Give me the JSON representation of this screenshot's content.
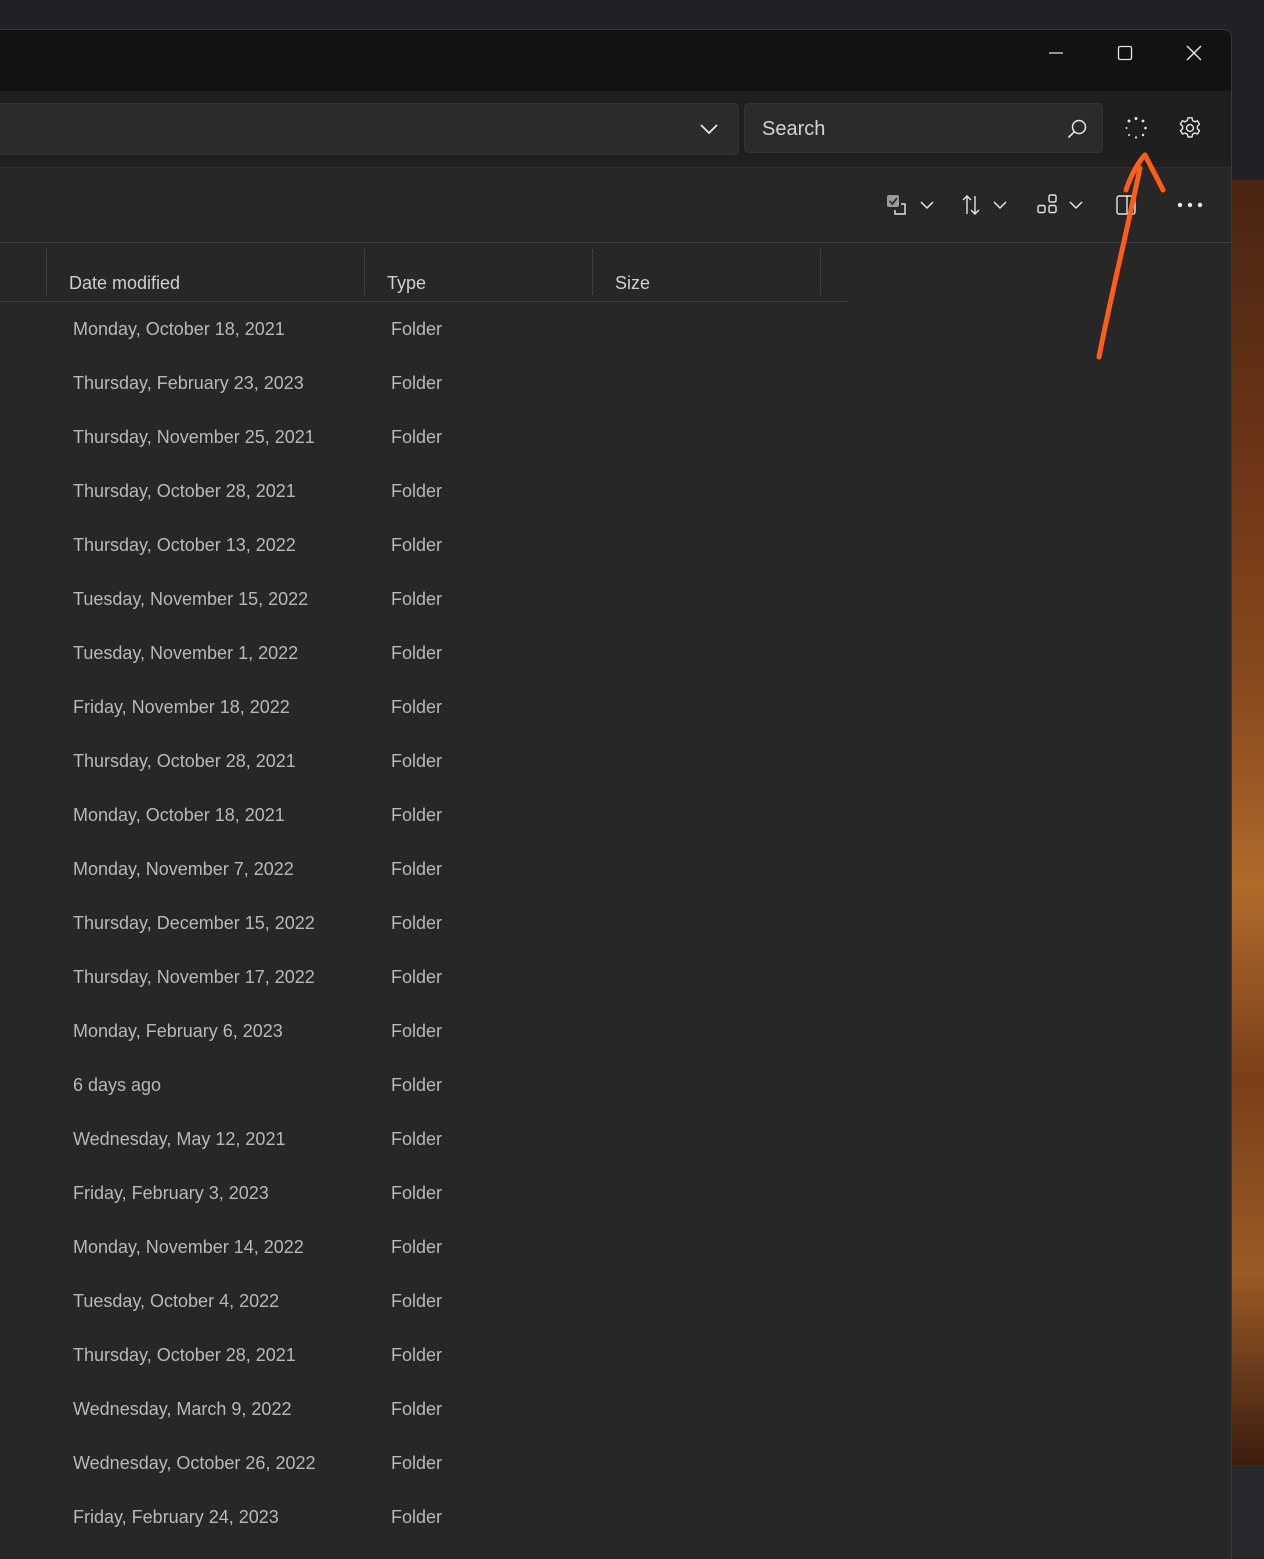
{
  "window": {
    "caption": {
      "minimize_icon": "minimize-icon",
      "maximize_icon": "maximize-icon",
      "close_icon": "close-icon"
    }
  },
  "address_bar": {
    "value": "",
    "dropdown_icon": "chevron-down-icon"
  },
  "search": {
    "placeholder": "Search",
    "icon": "search-icon"
  },
  "toolbar": {
    "sync_icon": "sync-status-icon",
    "settings_icon": "gear-icon",
    "select_icon": "select-check-icon",
    "sort_icon": "sort-icon",
    "layout_icon": "layout-icon",
    "preview_icon": "preview-pane-icon",
    "more_icon": "more-options-icon"
  },
  "columns": {
    "date_modified": "Date modified",
    "type": "Type",
    "size": "Size"
  },
  "rows": [
    {
      "date": "Monday, October 18, 2021",
      "type": "Folder"
    },
    {
      "date": "Thursday, February 23, 2023",
      "type": "Folder"
    },
    {
      "date": "Thursday, November 25, 2021",
      "type": "Folder"
    },
    {
      "date": "Thursday, October 28, 2021",
      "type": "Folder"
    },
    {
      "date": "Thursday, October 13, 2022",
      "type": "Folder"
    },
    {
      "date": "Tuesday, November 15, 2022",
      "type": "Folder"
    },
    {
      "date": "Tuesday, November 1, 2022",
      "type": "Folder"
    },
    {
      "date": "Friday, November 18, 2022",
      "type": "Folder"
    },
    {
      "date": "Thursday, October 28, 2021",
      "type": "Folder"
    },
    {
      "date": "Monday, October 18, 2021",
      "type": "Folder"
    },
    {
      "date": "Monday, November 7, 2022",
      "type": "Folder"
    },
    {
      "date": "Thursday, December 15, 2022",
      "type": "Folder"
    },
    {
      "date": "Thursday, November 17, 2022",
      "type": "Folder"
    },
    {
      "date": "Monday, February 6, 2023",
      "type": "Folder"
    },
    {
      "date": "6 days ago",
      "type": "Folder"
    },
    {
      "date": "Wednesday, May 12, 2021",
      "type": "Folder"
    },
    {
      "date": "Friday, February 3, 2023",
      "type": "Folder"
    },
    {
      "date": "Monday, November 14, 2022",
      "type": "Folder"
    },
    {
      "date": "Tuesday, October 4, 2022",
      "type": "Folder"
    },
    {
      "date": "Thursday, October 28, 2021",
      "type": "Folder"
    },
    {
      "date": "Wednesday, March 9, 2022",
      "type": "Folder"
    },
    {
      "date": "Wednesday, October 26, 2022",
      "type": "Folder"
    },
    {
      "date": "Friday, February 24, 2023",
      "type": "Folder"
    }
  ],
  "colors": {
    "annotation_arrow": "#ff5e14",
    "window_bg": "#272727",
    "titlebar_bg": "#121212"
  }
}
